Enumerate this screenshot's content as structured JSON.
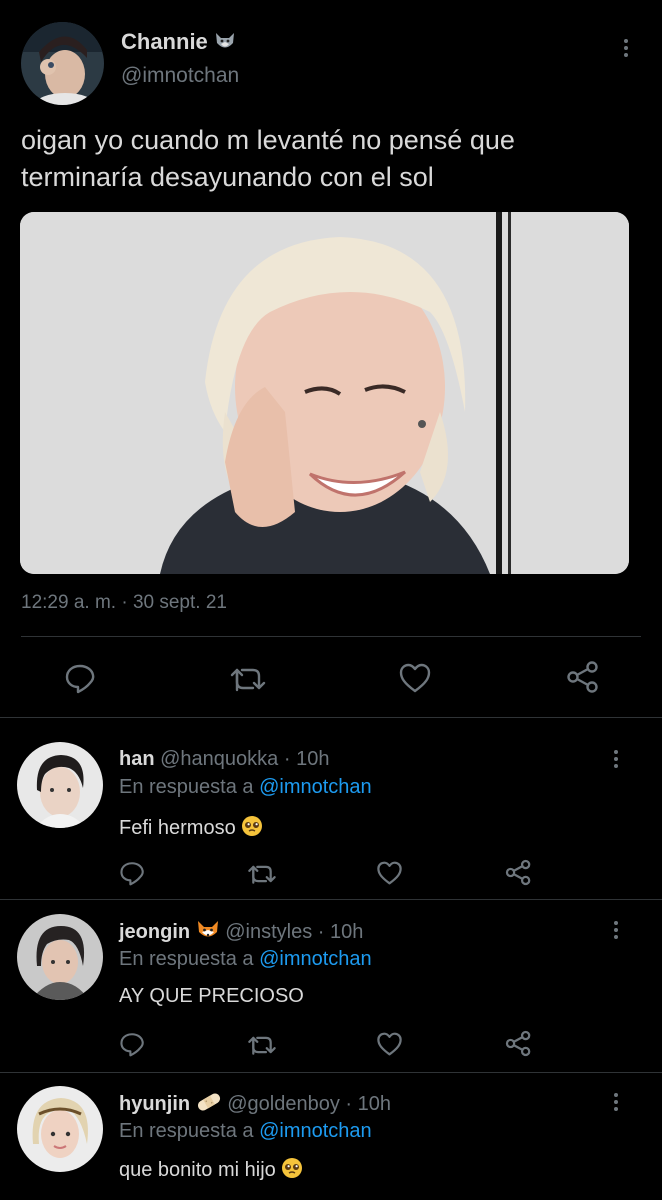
{
  "main_tweet": {
    "author_name": "Channie",
    "author_emoji": "wolf-emoji",
    "author_handle": "@imnotchan",
    "text_line1": "oigan yo cuando m levanté no pensé que",
    "text_line2": "terminaría desayunando con el sol",
    "timestamp": "12:29 a. m. · 30 sept. 21",
    "actions": [
      "reply-icon",
      "retweet-icon",
      "like-icon",
      "share-icon"
    ]
  },
  "replies": [
    {
      "name": "han",
      "handle": "@hanquokka",
      "time": "· 10h",
      "in_reply_prefix": "En respuesta a",
      "in_reply_handle": "@imnotchan",
      "text": "Fefi hermoso",
      "text_emoji": "pleading-face-emoji"
    },
    {
      "name": "jeongin",
      "name_emoji": "fox-emoji",
      "handle": "@instyles",
      "time": "· 10h",
      "in_reply_prefix": "En respuesta a",
      "in_reply_handle": "@imnotchan",
      "text": "AY QUE PRECIOSO"
    },
    {
      "name": "hyunjin",
      "name_emoji": "bandage-emoji",
      "handle": "@goldenboy",
      "time": "· 10h",
      "in_reply_prefix": "En respuesta a",
      "in_reply_handle": "@imnotchan",
      "text": "que bonito mi hijo",
      "text_emoji": "pleading-face-emoji"
    }
  ],
  "colors": {
    "background": "#000000",
    "text": "#d9d9d9",
    "secondary": "#6e767d",
    "link": "#1d9bf0",
    "divider": "#2f3336"
  }
}
